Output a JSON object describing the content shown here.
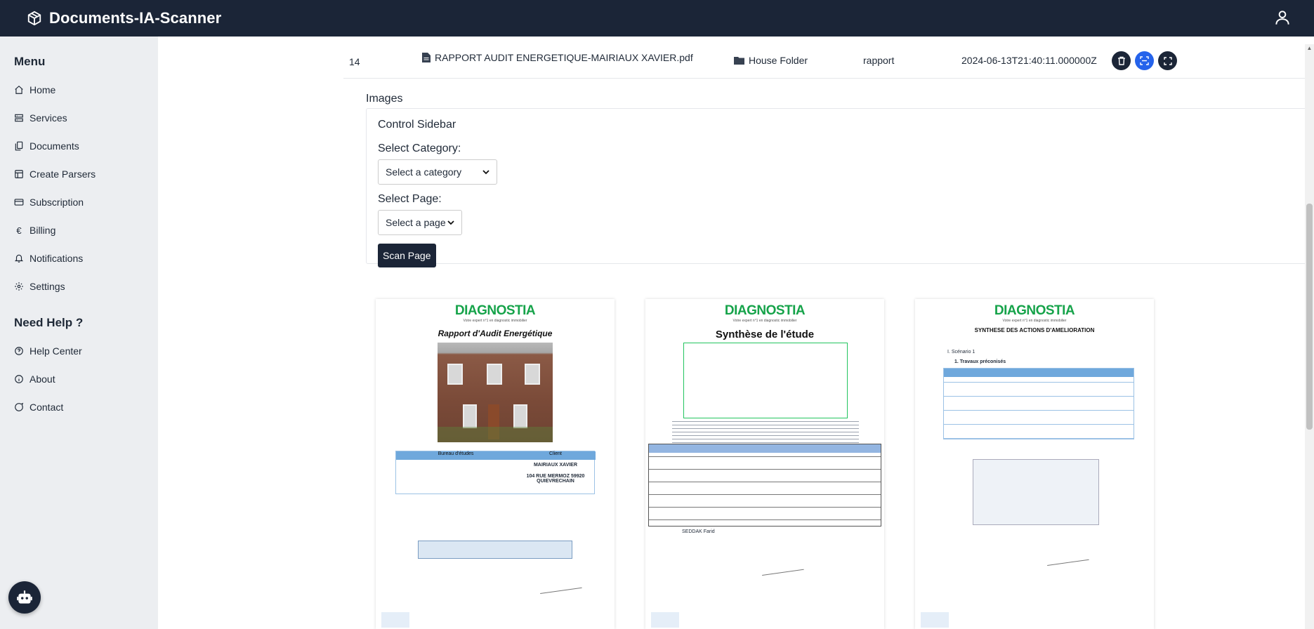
{
  "app": {
    "title": "Documents-IA-Scanner"
  },
  "sidebar": {
    "menu_heading": "Menu",
    "items": [
      {
        "label": "Home",
        "icon": "home-icon"
      },
      {
        "label": "Services",
        "icon": "services-icon"
      },
      {
        "label": "Documents",
        "icon": "documents-icon"
      },
      {
        "label": "Create Parsers",
        "icon": "parsers-icon"
      },
      {
        "label": "Subscription",
        "icon": "card-icon"
      },
      {
        "label": "Billing",
        "icon": "euro-icon"
      },
      {
        "label": "Notifications",
        "icon": "bell-icon"
      },
      {
        "label": "Settings",
        "icon": "gear-icon"
      }
    ],
    "help_heading": "Need Help ?",
    "help_items": [
      {
        "label": "Help Center",
        "icon": "help-circle-icon"
      },
      {
        "label": "About",
        "icon": "info-icon"
      },
      {
        "label": "Contact",
        "icon": "chat-icon"
      }
    ]
  },
  "document_row": {
    "id": "14",
    "filename": "RAPPORT AUDIT ENERGETIQUE-MAIRIAUX XAVIER.pdf",
    "folder": "House Folder",
    "type": "rapport",
    "date": "2024-06-13T21:40:11.000000Z"
  },
  "images": {
    "heading": "Images",
    "control_title": "Control Sidebar",
    "category_label": "Select Category:",
    "category_value": "Select a category",
    "page_label": "Select Page:",
    "page_value": "Select a page",
    "scan_button": "Scan Page"
  },
  "pages": [
    {
      "logo": "DIAGNOSTIA",
      "tagline": "Votre expert n°1 en diagnostic immobilier",
      "title": "Rapport d'Audit Energétique",
      "client": "MAIRIAUX XAVIER",
      "address": "104 RUE MERMOZ 59920 QUIEVRECHAIN",
      "bureau": "Bureau d'études",
      "client_heading": "Client"
    },
    {
      "logo": "DIAGNOSTIA",
      "tagline": "Votre expert n°1 en diagnostic immobilier",
      "title": "Synthèse de l'étude",
      "signature": "SEDDAK Farid"
    },
    {
      "logo": "DIAGNOSTIA",
      "tagline": "Votre expert n°1 en diagnostic immobilier",
      "title": "SYNTHESE DES ACTIONS D'AMELIORATION",
      "scenario": "I.   Scénario 1",
      "sub": "1.  Travaux préconisés"
    }
  ]
}
